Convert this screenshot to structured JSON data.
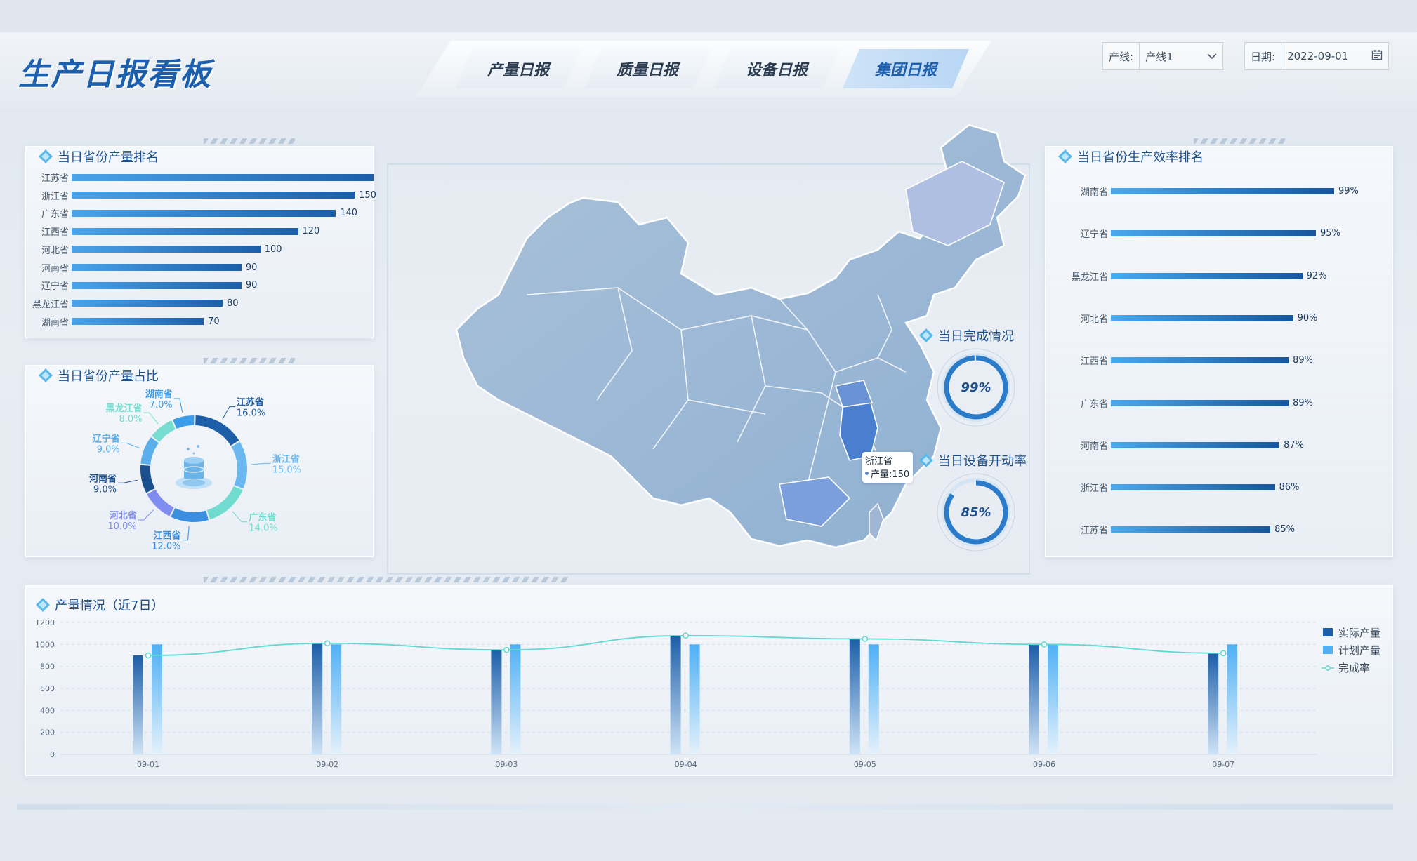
{
  "header": {
    "title": "生产日报看板",
    "tabs": [
      {
        "label": "产量日报",
        "active": false
      },
      {
        "label": "质量日报",
        "active": false
      },
      {
        "label": "设备日报",
        "active": false
      },
      {
        "label": "集团日报",
        "active": true
      }
    ],
    "line_filter": {
      "label": "产线:",
      "value": "产线1"
    },
    "date_filter": {
      "label": "日期:",
      "value": "2022-09-01"
    }
  },
  "rank_panel": {
    "title": "当日省份产量排名",
    "items": [
      {
        "province": "江苏省",
        "value": 160,
        "value_label": ""
      },
      {
        "province": "浙江省",
        "value": 150,
        "value_label": "150"
      },
      {
        "province": "广东省",
        "value": 140,
        "value_label": "140"
      },
      {
        "province": "江西省",
        "value": 120,
        "value_label": "120"
      },
      {
        "province": "河北省",
        "value": 100,
        "value_label": "100"
      },
      {
        "province": "河南省",
        "value": 90,
        "value_label": "90"
      },
      {
        "province": "辽宁省",
        "value": 90,
        "value_label": "90"
      },
      {
        "province": "黑龙江省",
        "value": 80,
        "value_label": "80"
      },
      {
        "province": "湖南省",
        "value": 70,
        "value_label": "70"
      }
    ]
  },
  "share_panel": {
    "title": "当日省份产量占比",
    "slices": [
      {
        "name": "江苏省",
        "pct": 16.0,
        "pct_label": "16.0%",
        "color": "#1c5ea8"
      },
      {
        "name": "浙江省",
        "pct": 15.0,
        "pct_label": "15.0%",
        "color": "#6bb8f0"
      },
      {
        "name": "广东省",
        "pct": 14.0,
        "pct_label": "14.0%",
        "color": "#6fdccf"
      },
      {
        "name": "江西省",
        "pct": 12.0,
        "pct_label": "12.0%",
        "color": "#3c8fe0"
      },
      {
        "name": "河北省",
        "pct": 10.0,
        "pct_label": "10.0%",
        "color": "#7f8cf0"
      },
      {
        "name": "河南省",
        "pct": 9.0,
        "pct_label": "9.0%",
        "color": "#1b4f8e"
      },
      {
        "name": "辽宁省",
        "pct": 9.0,
        "pct_label": "9.0%",
        "color": "#5aaeea"
      },
      {
        "name": "黑龙江省",
        "pct": 8.0,
        "pct_label": "8.0%",
        "color": "#76ddd0"
      },
      {
        "name": "湖南省",
        "pct": 7.0,
        "pct_label": "7.0%",
        "color": "#3b9de9"
      }
    ]
  },
  "map": {
    "tooltip": {
      "province": "浙江省",
      "metric": "产量:150"
    },
    "highlight_color": "#4a7fd0"
  },
  "completion": {
    "title": "当日完成情况",
    "value": 0.99,
    "label": "99%"
  },
  "equipment": {
    "title": "当日设备开动率",
    "value": 0.85,
    "label": "85%"
  },
  "efficiency_panel": {
    "title": "当日省份生产效率排名",
    "items": [
      {
        "province": "湖南省",
        "value": 99,
        "label": "99%"
      },
      {
        "province": "辽宁省",
        "value": 95,
        "label": "95%"
      },
      {
        "province": "黑龙江省",
        "value": 92,
        "label": "92%"
      },
      {
        "province": "河北省",
        "value": 90,
        "label": "90%"
      },
      {
        "province": "江西省",
        "value": 89,
        "label": "89%"
      },
      {
        "province": "广东省",
        "value": 89,
        "label": "89%"
      },
      {
        "province": "河南省",
        "value": 87,
        "label": "87%"
      },
      {
        "province": "浙江省",
        "value": 86,
        "label": "86%"
      },
      {
        "province": "江苏省",
        "value": 85,
        "label": "85%"
      }
    ]
  },
  "production_panel": {
    "title": "产量情况（近7日）"
  },
  "chart_data": {
    "type": "bar",
    "categories": [
      "09-01",
      "09-02",
      "09-03",
      "09-04",
      "09-05",
      "09-06",
      "09-07"
    ],
    "ylim": [
      0,
      1200
    ],
    "yticks": [
      "0",
      "200",
      "400",
      "600",
      "800",
      "1000",
      "1200"
    ],
    "series": [
      {
        "name": "实际产量",
        "type": "bar",
        "values": [
          900,
          1010,
          950,
          1080,
          1050,
          1000,
          920
        ],
        "color": "#1c5ea8"
      },
      {
        "name": "计划产量",
        "type": "bar",
        "values": [
          1000,
          1000,
          1000,
          1000,
          1000,
          1000,
          1000
        ],
        "color": "#4fb0f5"
      },
      {
        "name": "完成率",
        "type": "line",
        "values": [
          900,
          1010,
          950,
          1080,
          1050,
          1000,
          920
        ],
        "color": "#5fd8cf"
      }
    ],
    "legend_position": "top-right"
  }
}
